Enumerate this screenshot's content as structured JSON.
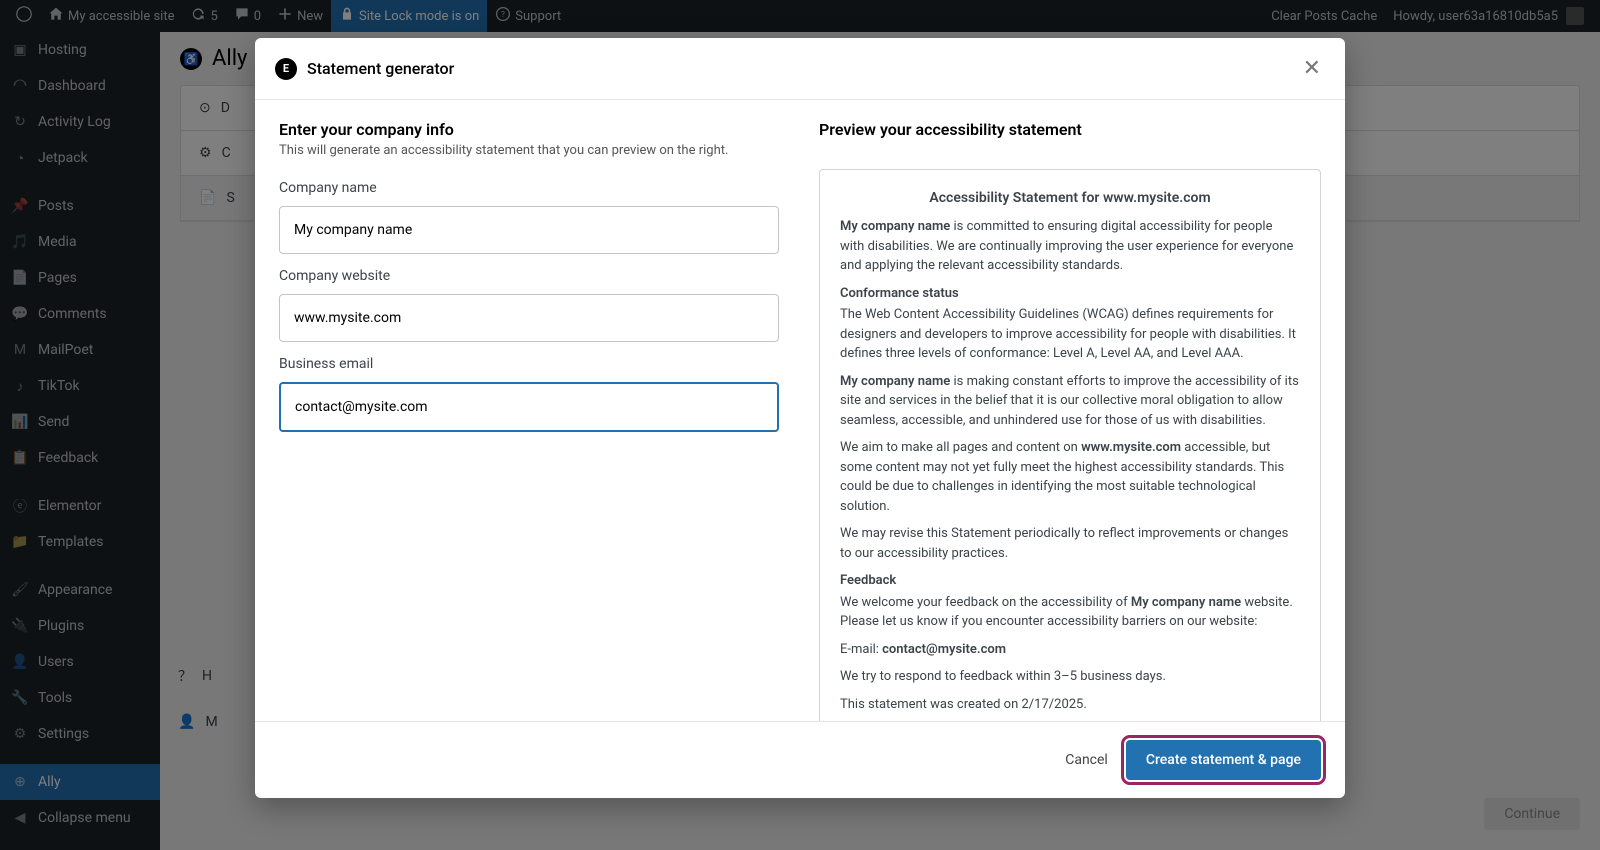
{
  "admin_bar": {
    "site_name": "My accessible site",
    "updates_count": "5",
    "comments_count": "0",
    "new_label": "New",
    "lock_label": "Site Lock mode is on",
    "support_label": "Support",
    "clear_cache": "Clear Posts Cache",
    "howdy": "Howdy, user63a16810db5a5"
  },
  "sidebar": {
    "items": [
      {
        "label": "Hosting",
        "icon": "hosting"
      },
      {
        "label": "Dashboard",
        "icon": "dashboard"
      },
      {
        "label": "Activity Log",
        "icon": "activity"
      },
      {
        "label": "Jetpack",
        "icon": "jetpack"
      },
      {
        "label": "Posts",
        "icon": "posts"
      },
      {
        "label": "Media",
        "icon": "media"
      },
      {
        "label": "Pages",
        "icon": "pages"
      },
      {
        "label": "Comments",
        "icon": "comments"
      },
      {
        "label": "MailPoet",
        "icon": "mailpoet"
      },
      {
        "label": "TikTok",
        "icon": "tiktok"
      },
      {
        "label": "Send",
        "icon": "send"
      },
      {
        "label": "Feedback",
        "icon": "feedback"
      },
      {
        "label": "Elementor",
        "icon": "elementor"
      },
      {
        "label": "Templates",
        "icon": "templates"
      },
      {
        "label": "Appearance",
        "icon": "appearance"
      },
      {
        "label": "Plugins",
        "icon": "plugins"
      },
      {
        "label": "Users",
        "icon": "users"
      },
      {
        "label": "Tools",
        "icon": "tools"
      },
      {
        "label": "Settings",
        "icon": "settings"
      },
      {
        "label": "Ally",
        "icon": "ally"
      },
      {
        "label": "Collapse menu",
        "icon": "collapse"
      }
    ]
  },
  "page": {
    "title": "Ally",
    "tabs": {
      "d": "D",
      "c": "C",
      "s": "S"
    },
    "help": "H",
    "account": "M",
    "continue": "Continue"
  },
  "modal": {
    "title": "Statement generator",
    "form": {
      "heading": "Enter your company info",
      "subtitle": "This will generate an accessibility statement that you can preview on the right.",
      "company_name_label": "Company name",
      "company_name_value": "My company name",
      "company_website_label": "Company website",
      "company_website_value": "www.mysite.com",
      "business_email_label": "Business email",
      "business_email_value": "contact@mysite.com"
    },
    "preview": {
      "heading": "Preview your accessibility statement",
      "title_prefix": "Accessibility Statement for ",
      "website": "www.mysite.com",
      "company": "My company name",
      "p1_suffix": " is committed to ensuring digital accessibility for people with disabilities. We are continually improving the user experience for everyone and applying the relevant accessibility standards.",
      "conformance_heading": "Conformance status",
      "p2": "The Web Content Accessibility Guidelines (WCAG) defines requirements for designers and developers to improve accessibility for people with disabilities. It defines three levels of conformance: Level A, Level AA, and Level AAA.",
      "p3_suffix": " is making constant efforts to improve the accessibility of its site and services in the belief that it is our collective moral obligation to allow seamless, accessible, and unhindered use for those of us with disabilities.",
      "p4_prefix": "We aim to make all pages and content on ",
      "p4_suffix": " accessible, but some content may not yet fully meet the highest accessibility standards. This could be due to challenges in identifying the most suitable technological solution.",
      "p5": "We may revise this Statement periodically to reflect improvements or changes to our accessibility practices.",
      "feedback_heading": "Feedback",
      "p6_prefix": "We welcome your feedback on the accessibility of ",
      "p6_suffix": " website. Please let us know if you encounter accessibility barriers on our website:",
      "email_prefix": "E-mail: ",
      "email": "contact@mysite.com",
      "p7": "We try to respond to feedback within 3–5 business days.",
      "p8": "This statement was created on 2/17/2025."
    },
    "footer": {
      "cancel": "Cancel",
      "create": "Create statement & page"
    }
  }
}
